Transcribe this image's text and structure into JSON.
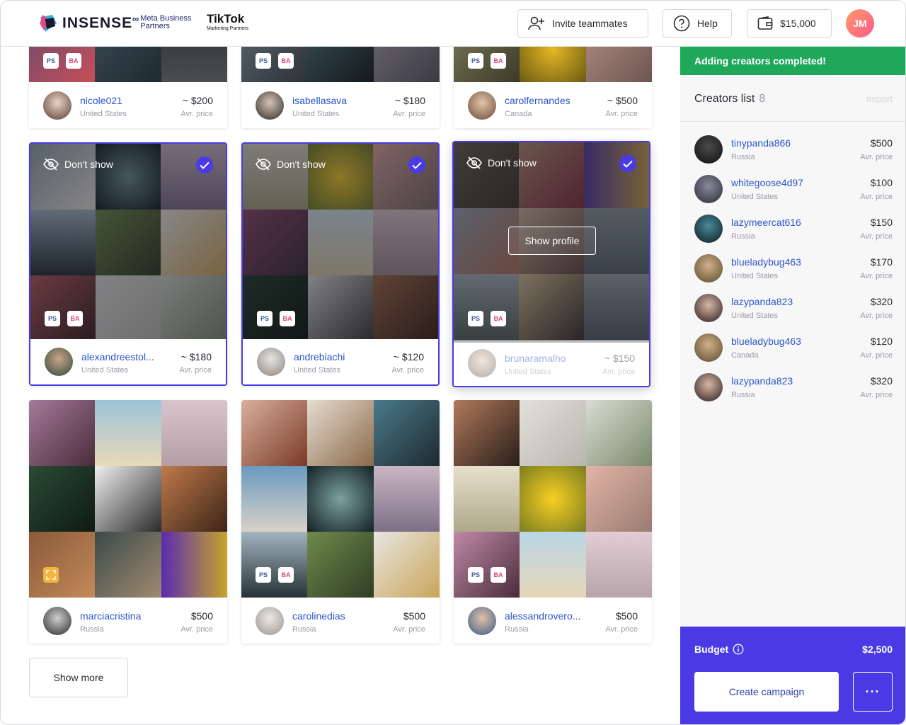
{
  "header": {
    "brand": "INSENSE",
    "meta_partner_line1": "Meta Business",
    "meta_partner_line2": "Partners",
    "tiktok_line1": "TikTok",
    "tiktok_line2": "Marketing Partners",
    "invite_label": "Invite teammates",
    "help_label": "Help",
    "balance": "$15,000",
    "user_initials": "JM"
  },
  "badges": {
    "ps": "PS",
    "ba": "BA"
  },
  "grid": {
    "dont_show_label": "Don't show",
    "show_profile_label": "Show profile",
    "avr_price_label": "Avr. price",
    "show_more_label": "Show more",
    "cards": [
      {
        "name": "nicole021",
        "country": "United States",
        "price": "~ $200"
      },
      {
        "name": "isabellasava",
        "country": "United States",
        "price": "~ $180"
      },
      {
        "name": "carolfernandes",
        "country": "Canada",
        "price": "~ $500"
      },
      {
        "name": "alexandreestol...",
        "country": "United States",
        "price": "~ $180"
      },
      {
        "name": "andrebiachi",
        "country": "United States",
        "price": "~ $120"
      },
      {
        "name": "brunaramalho",
        "country": "United States",
        "price": "~ $150"
      },
      {
        "name": "marciacristina",
        "country": "Russia",
        "price": "$500"
      },
      {
        "name": "carolinedias",
        "country": "Russia",
        "price": "$500"
      },
      {
        "name": "alessandrovero...",
        "country": "Russia",
        "price": "$500"
      }
    ]
  },
  "sidebar": {
    "banner": "Adding creators completed!",
    "list_title": "Creators list",
    "list_count": "8",
    "import_label": "Import",
    "avr_price_label": "Avr. price",
    "creators": [
      {
        "name": "tinypanda866",
        "country": "Russia",
        "price": "$500"
      },
      {
        "name": "whitegoose4d97",
        "country": "United States",
        "price": "$100"
      },
      {
        "name": "lazymeercat616",
        "country": "Russia",
        "price": "$150"
      },
      {
        "name": "blueladybug463",
        "country": "United States",
        "price": "$170"
      },
      {
        "name": "lazypanda823",
        "country": "United States",
        "price": "$320"
      },
      {
        "name": "blueladybug463",
        "country": "Canada",
        "price": "$120"
      },
      {
        "name": "lazypanda823",
        "country": "Russia",
        "price": "$320"
      }
    ],
    "budget_label": "Budget",
    "budget_value": "$2,500",
    "create_label": "Create campaign",
    "more_label": "···"
  },
  "colors": {
    "accent": "#4a3ae6",
    "success": "#1fa85a",
    "link": "#2a57c9"
  }
}
